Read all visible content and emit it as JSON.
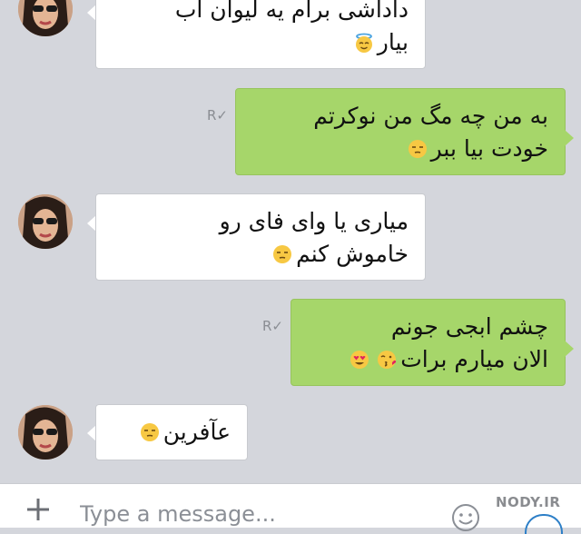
{
  "messages": [
    {
      "side": "in",
      "text": "داداشی برام یه لیوان آب",
      "text2": "بیار",
      "emoji": "angel-emoji"
    },
    {
      "side": "out",
      "receipt": "R✓",
      "text": "به من چه مگ من نوکرتم",
      "text2": "خودت بیا ببر",
      "emoji": "unamused-emoji"
    },
    {
      "side": "in",
      "text": "میاری یا وای فای رو",
      "text2": "خاموش کنم",
      "emoji": "unamused-emoji"
    },
    {
      "side": "out",
      "receipt": "R✓",
      "text": "چشم ابجی جونم",
      "text2": "الان میارم برات",
      "emoji": "heart-eyes-and-kiss-emoji"
    },
    {
      "side": "in",
      "text": "عآفرین",
      "emoji": "unamused-emoji"
    }
  ],
  "composer": {
    "placeholder": "Type a message...",
    "add_icon": "plus-icon",
    "emoji_icon": "smiley-icon"
  },
  "watermark": {
    "text": "NODY.IR"
  },
  "colors": {
    "outgoing": "#a6d66a",
    "incoming": "#ffffff",
    "background": "#d4d6dc"
  }
}
